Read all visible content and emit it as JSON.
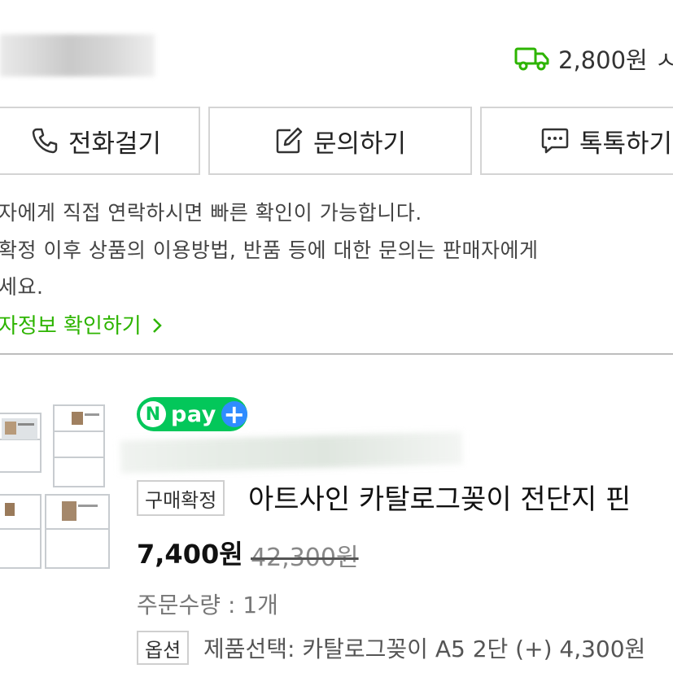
{
  "shipping": {
    "fee": "2,800원 ㅅ"
  },
  "contact_buttons": [
    {
      "label": "전화걸기",
      "icon": "phone-icon"
    },
    {
      "label": "문의하기",
      "icon": "edit-icon"
    },
    {
      "label": "톡톡하기",
      "icon": "chat-bubble-icon"
    }
  ],
  "notice": {
    "line1": "자에게 직접 연락하시면 빠른 확인이 가능합니다.",
    "line2": "확정 이후 상품의 이용방법, 반품 등에 대한 문의는 판매자에게",
    "line3": "세요.",
    "seller_link": "자정보 확인하기"
  },
  "product": {
    "npay_badge": "pay",
    "status_badge": "구매확정",
    "title": "아트사인 카탈로그꽂이 전단지 핀",
    "price": "7,400원",
    "original_price": "42,300원",
    "quantity": "주문수량 : 1개",
    "option_badge": "옵션",
    "option_text": "제품선택: 카탈로그꽂이 A5 2단 (+) 4,300원"
  },
  "colors": {
    "accent_green": "#03c75a",
    "link_green": "#2db400",
    "npay_plus": "#2f8cff"
  }
}
